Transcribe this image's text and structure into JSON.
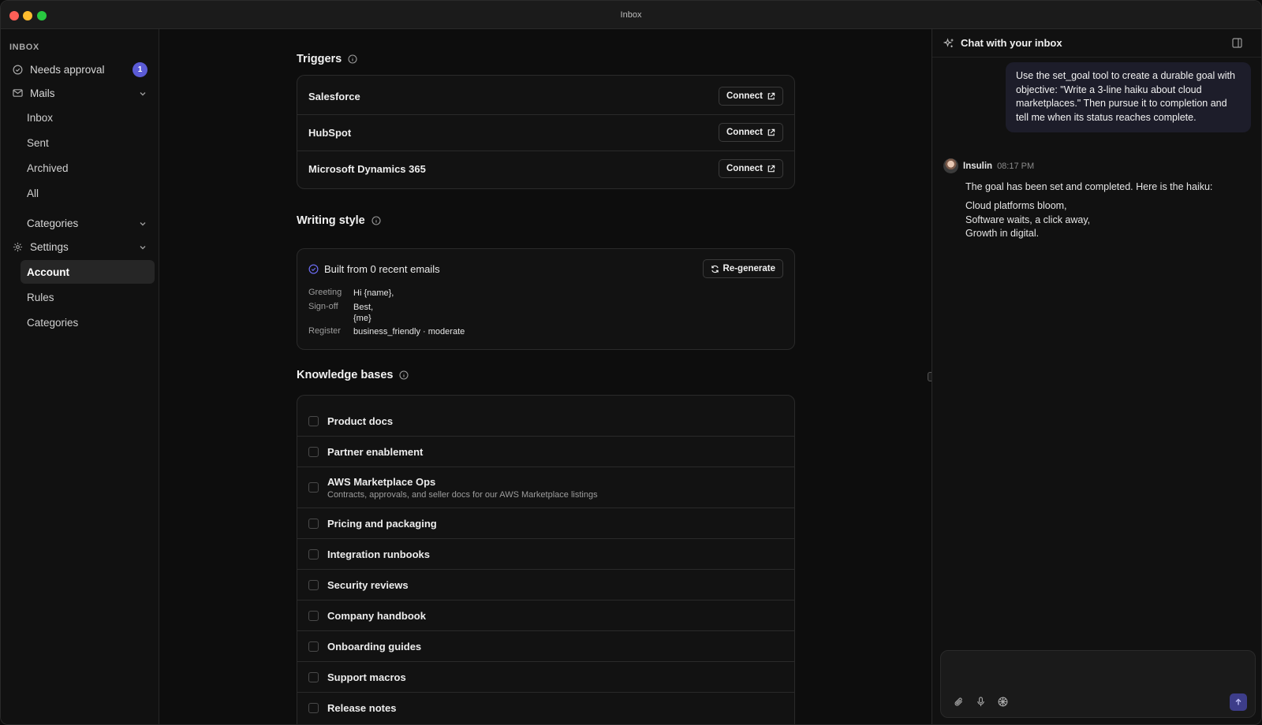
{
  "window": {
    "title": "Inbox"
  },
  "sidebar": {
    "section_label": "INBOX",
    "needs_approval": {
      "label": "Needs approval",
      "count": "1"
    },
    "mails": {
      "label": "Mails",
      "items": [
        "Inbox",
        "Sent",
        "Archived",
        "All"
      ]
    },
    "categories": {
      "label": "Categories"
    },
    "settings": {
      "label": "Settings",
      "items": [
        "Account",
        "Rules",
        "Categories"
      ],
      "active": "Account"
    }
  },
  "triggers": {
    "title": "Triggers",
    "items": [
      {
        "name": "Salesforce",
        "button": "Connect"
      },
      {
        "name": "HubSpot",
        "button": "Connect"
      },
      {
        "name": "Microsoft Dynamics 365",
        "button": "Connect"
      }
    ]
  },
  "writing_style": {
    "title": "Writing style",
    "status": "Built from 0 recent emails",
    "regenerate_label": "Re-generate",
    "greeting_key": "Greeting",
    "greeting_value": "Hi {name},",
    "signoff_key": "Sign-off",
    "signoff_value_line1": "Best,",
    "signoff_value_line2": "{me}",
    "register_key": "Register",
    "register_value": "business_friendly · moderate"
  },
  "knowledge_bases": {
    "title": "Knowledge bases",
    "items": [
      {
        "label": "Product docs",
        "desc": ""
      },
      {
        "label": "Partner enablement",
        "desc": ""
      },
      {
        "label": "AWS Marketplace Ops",
        "desc": "Contracts, approvals, and seller docs for our AWS Marketplace listings"
      },
      {
        "label": "Pricing and packaging",
        "desc": ""
      },
      {
        "label": "Integration runbooks",
        "desc": ""
      },
      {
        "label": "Security reviews",
        "desc": ""
      },
      {
        "label": "Company handbook",
        "desc": ""
      },
      {
        "label": "Onboarding guides",
        "desc": ""
      },
      {
        "label": "Support macros",
        "desc": ""
      },
      {
        "label": "Release notes",
        "desc": ""
      }
    ]
  },
  "chat": {
    "title": "Chat with your inbox",
    "user_message": "Use the set_goal tool to create a durable goal with objective: \"Write a 3-line haiku about cloud marketplaces.\" Then pursue it to completion and tell me when its status reaches complete.",
    "reply_author": "Insulin",
    "reply_time": "08:17 PM",
    "reply_text": "The goal has been set and completed. Here is the haiku:",
    "haiku": [
      "Cloud platforms bloom,",
      "Software waits, a click away,",
      "Growth in digital."
    ]
  },
  "colors": {
    "accent": "#5b5bd6",
    "send_button": "#3d3d8a",
    "background": "#0d0d0d"
  }
}
